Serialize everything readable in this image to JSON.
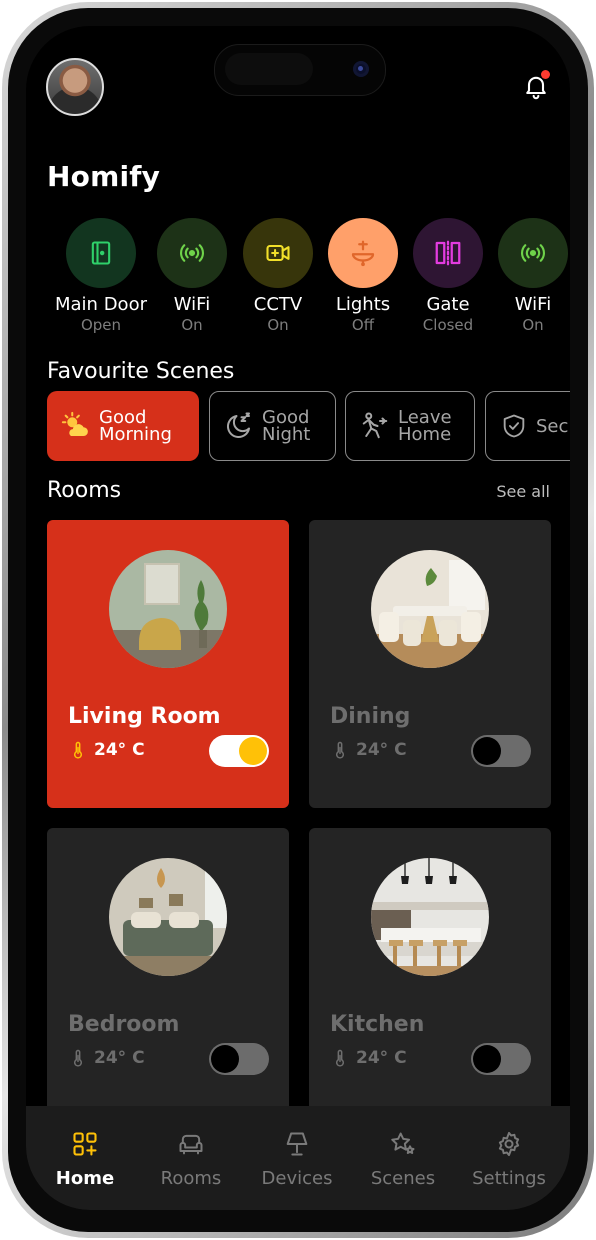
{
  "app": {
    "title": "Homify"
  },
  "devices": [
    {
      "name": "Main Door",
      "state": "Open",
      "icon": "door-icon",
      "bg": "#12351f",
      "fg": "#2fd06a"
    },
    {
      "name": "WiFi",
      "state": "On",
      "icon": "wifi-icon",
      "bg": "#1d3217",
      "fg": "#6fd24a"
    },
    {
      "name": "CCTV",
      "state": "On",
      "icon": "cctv-icon",
      "bg": "#37350b",
      "fg": "#f2e02a"
    },
    {
      "name": "Lights",
      "state": "Off",
      "icon": "lamp-icon",
      "bg": "#ffa06a",
      "fg": "#e0662a"
    },
    {
      "name": "Gate",
      "state": "Closed",
      "icon": "gate-icon",
      "bg": "#2e1533",
      "fg": "#e33ce0"
    },
    {
      "name": "WiFi",
      "state": "On",
      "icon": "wifi-icon",
      "bg": "#1d3217",
      "fg": "#6fd24a"
    }
  ],
  "scenes_title": "Favourite Scenes",
  "scenes": [
    {
      "line1": "Good",
      "line2": "Morning",
      "icon": "sun-cloud-icon"
    },
    {
      "line1": "Good",
      "line2": "Night",
      "icon": "moon-sleep-icon"
    },
    {
      "line1": "Leave",
      "line2": "Home",
      "icon": "walk-icon"
    },
    {
      "line1": "Sec",
      "line2": "",
      "icon": "shield-icon"
    }
  ],
  "rooms_title": "Rooms",
  "see_all": "See all",
  "rooms": [
    {
      "name": "Living Room",
      "temp": "24° C",
      "on": true
    },
    {
      "name": "Dining",
      "temp": "24° C",
      "on": false
    },
    {
      "name": "Bedroom",
      "temp": "24° C",
      "on": false
    },
    {
      "name": "Kitchen",
      "temp": "24° C",
      "on": false
    }
  ],
  "nav": [
    {
      "label": "Home",
      "icon": "home-grid-icon"
    },
    {
      "label": "Rooms",
      "icon": "sofa-icon"
    },
    {
      "label": "Devices",
      "icon": "lamp-icon"
    },
    {
      "label": "Scenes",
      "icon": "stars-icon"
    },
    {
      "label": "Settings",
      "icon": "gear-icon"
    }
  ],
  "colors": {
    "accent": "#d6301a",
    "toggle_on": "#ffc107",
    "temp_icon_active": "#ffc107"
  }
}
